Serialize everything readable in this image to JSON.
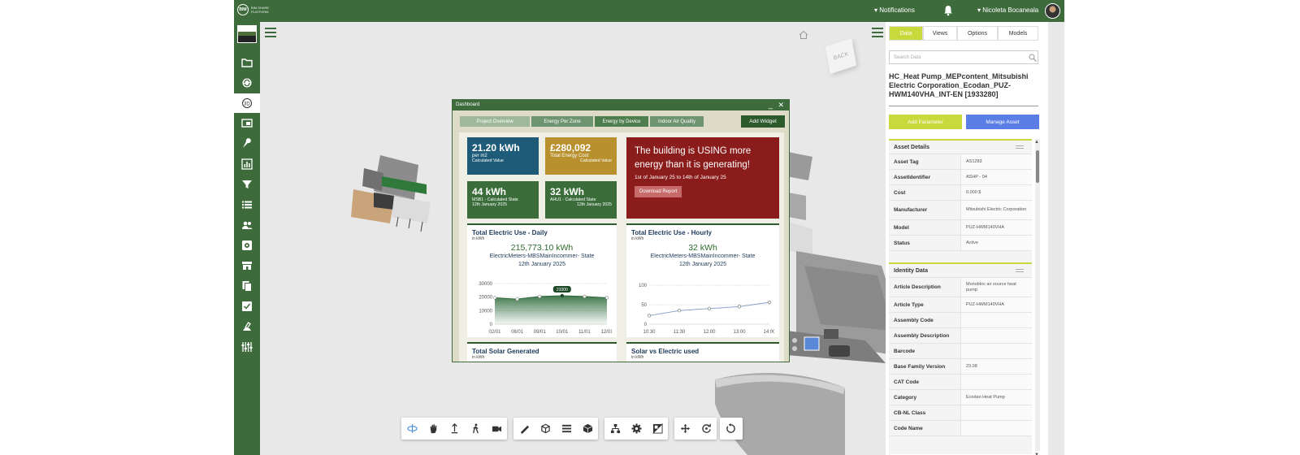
{
  "topbar": {
    "logo_abbr": "BIM",
    "logo_text": "BIM SHARE PLATFORM",
    "notifications_label": "▾ Notifications",
    "user_label": "▾ Nicoleta Bocaneala"
  },
  "viewport": {
    "cube_label": "BACK"
  },
  "dashboard": {
    "title": "Dashboard",
    "controls": "_ ✕",
    "tabs": [
      "Project Overview",
      "Energy Per Zone",
      "Energy by Device",
      "Indoor Air Quality"
    ],
    "add_widget": "Add Widget",
    "tiles": {
      "t1": {
        "value": "21.20 kWh",
        "line1": "per m2",
        "line2": "Calculated Value"
      },
      "t2": {
        "value": "£280,092",
        "line1": "Total Energy Cost",
        "line2": "Calculated Value"
      },
      "t3": {
        "value": "44 kWh",
        "line1": "MSB1 - Calculated State",
        "line2": "12th January 2025"
      },
      "t4": {
        "value": "32 kWh",
        "line1": "AHU1 - Calculated State",
        "line2": "12th January 2025"
      },
      "alert": {
        "text": "The building is USING more energy than it is generating!",
        "range": "1st of January 25 to 14th of January 25",
        "button": "Download Report"
      }
    },
    "daily": {
      "title": "Total Electric Use - Daily",
      "unit": "in kWh",
      "value": "215,773.10 kWh",
      "subtitle1": "ElectricMeters-MBSMainIncommer- State",
      "subtitle2": "12th January 2025",
      "tooltip": "21000"
    },
    "hourly": {
      "title": "Total Electric Use - Hourly",
      "unit": "in kWh",
      "value": "32 kWh",
      "subtitle1": "ElectricMeters-MBSMainIncommer- State",
      "subtitle2": "12th January 2025"
    },
    "solar": {
      "title": "Total Solar Generated",
      "unit": "in kWh"
    },
    "solar_vs": {
      "title": "Solar vs Electric used",
      "unit": "in kWh"
    }
  },
  "chart_data": [
    {
      "type": "area",
      "title": "Total Electric Use - Daily",
      "x": [
        "02/01",
        "08/01",
        "09/01",
        "10/01",
        "11/01",
        "12/01"
      ],
      "values": [
        19500,
        18500,
        20500,
        21000,
        20500,
        19500
      ],
      "yticks": [
        "30000",
        "20000",
        "10000",
        "0"
      ],
      "ylim": [
        0,
        30000
      ],
      "color": "#2d6a3a"
    },
    {
      "type": "line",
      "title": "Total Electric Use - Hourly",
      "x": [
        "10:30",
        "11:30",
        "12:00",
        "13:00",
        "14:00"
      ],
      "values": [
        22,
        35,
        40,
        45,
        56
      ],
      "yticks": [
        "100",
        "50",
        "0"
      ],
      "ylim": [
        0,
        100
      ],
      "color": "#8aa2c8"
    }
  ],
  "right_panel": {
    "tabs": [
      "Data",
      "Views",
      "Options",
      "Models"
    ],
    "search_placeholder": "Search Data",
    "title": "HC_Heat Pump_MEPcontent_Mitsubishi Electric Corporation_Ecodan_PUZ-HWM140VHA_INT-EN [1933280]",
    "add_parameter": "Add Parameter",
    "manage_asset": "Manage Asset",
    "asset_details": {
      "header": "Asset Details",
      "rows": [
        [
          "Asset Tag",
          "AS1283"
        ],
        [
          "AssetIdentifier",
          "ASHP - 04"
        ],
        [
          "Cost",
          "0.000 $"
        ],
        [
          "Manufacturer",
          "Mitsubishi Electric Corporation"
        ],
        [
          "Model",
          "PUZ-HWM140VHA"
        ],
        [
          "Status",
          "Active"
        ]
      ]
    },
    "identity_data": {
      "header": "Identity Data",
      "rows": [
        [
          "Article Description",
          "Monobloc air source heat pump"
        ],
        [
          "Article Type",
          "PUZ-HWM140VHA"
        ],
        [
          "Assembly Code",
          ""
        ],
        [
          "Assembly Description",
          ""
        ],
        [
          "Barcode",
          ""
        ],
        [
          "Base Family Version",
          "23.08"
        ],
        [
          "CAT Code",
          ""
        ],
        [
          "Category",
          "Ecodan Heat Pump"
        ],
        [
          "CB-NL Class",
          ""
        ],
        [
          "Code Name",
          ""
        ]
      ]
    }
  },
  "colors": {
    "brand_green": "#3e6b3c",
    "accent_lime": "#c8d93b",
    "accent_blue": "#5b7de6",
    "alert_red": "#8b1c1c"
  }
}
